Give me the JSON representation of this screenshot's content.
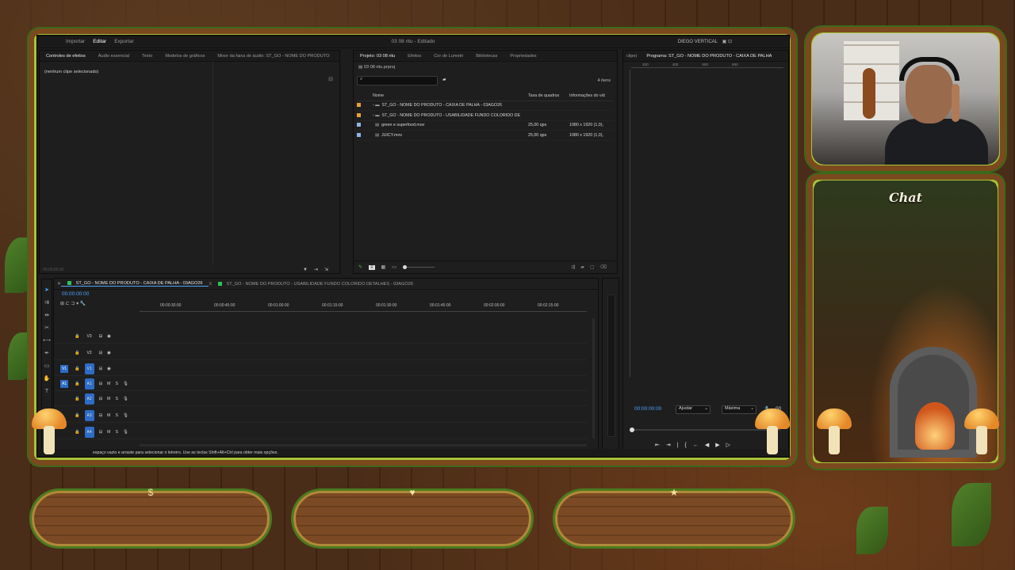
{
  "overlay": {
    "chat_title": "Chat",
    "plank_gems": [
      "$",
      "♥",
      "★"
    ]
  },
  "premiere": {
    "menu": [
      "Importar",
      "Editar",
      "Exportar"
    ],
    "active_menu": "Editar",
    "document_title": "03 08 ritu - Editado",
    "workspace": "DIEGO VERTICAL",
    "effect_panel": {
      "tabs": [
        "Controles de efeitos",
        "Áudio essencial",
        "Texto",
        "Modelos de gráficos",
        "Mixer da faixa de áudio: ST_GO - NOME DO PRODUTO"
      ],
      "no_clip": "(nenhum clipe selecionado)",
      "timecode": "00:00:00:00"
    },
    "project_panel": {
      "tabs": [
        "Projeto: 03 08 ritu",
        "Efeitos",
        "Cor de Lumetri",
        "Bibliotecas",
        "Propriedades"
      ],
      "path": "03 08 ritu.prproj",
      "search_placeholder": "",
      "item_count": "4 itens",
      "columns": [
        "Nome",
        "Taxa de quadros",
        "Informações do vid"
      ],
      "rows": [
        {
          "name": "ST_GO - NOME DO PRODUTO - CAIXA DE PALHA - 03AGO26",
          "fps": "",
          "info": "",
          "color": "#e8a03a",
          "kind": "folder"
        },
        {
          "name": "ST_GO - NOME DO PRODUTO - USABILIDADE FUNDO COLORIDO DE",
          "fps": "",
          "info": "",
          "color": "#e8a03a",
          "kind": "folder"
        },
        {
          "name": "green e superfood.mov",
          "fps": "25,00 qps",
          "info": "1080 x 1920 (1,0),",
          "color": "#8fb5e8",
          "kind": "clip"
        },
        {
          "name": "JUICY.mov",
          "fps": "25,00 qps",
          "info": "1080 x 1920 (1,0),",
          "color": "#8fb5e8",
          "kind": "clip"
        }
      ]
    },
    "program_monitor": {
      "tab_prefix": "clipe)",
      "tab": "Programa: ST_GO - NOME DO PRODUTO - CAIXA DE PALHA",
      "ruler_labels": [
        "200",
        "400",
        "600",
        "800"
      ],
      "timecode": "00:00:00:00",
      "fit": "Ajustar",
      "quality": "Máxima",
      "right_code": "00"
    },
    "timeline": {
      "tabs": [
        "ST_GO - NOME DO PRODUTO - CAIXA DE PALHA - 03AGO26",
        "ST_GO - NOME DO PRODUTO - USABILIDADE FUNDO COLORIDO DETALHES - 03AGO26"
      ],
      "timecode": "00:00:00:00",
      "ruler": [
        "00:00:30:00",
        "00:00:45:00",
        "00:01:00:00",
        "00:01:15:00",
        "00:01:30:00",
        "00:01:45:00",
        "00:02:00:00",
        "00:02:15:00"
      ],
      "video_tracks": [
        "V3",
        "V2",
        "V1"
      ],
      "audio_tracks": [
        "A1",
        "A2",
        "A3",
        "A4"
      ],
      "source_v": "V1",
      "source_a": "A1"
    },
    "status_text": "espaço vazio e arraste para selecionar o letreiro. Use as teclas Shift+Alt+Ctrl para obter mais opções."
  }
}
